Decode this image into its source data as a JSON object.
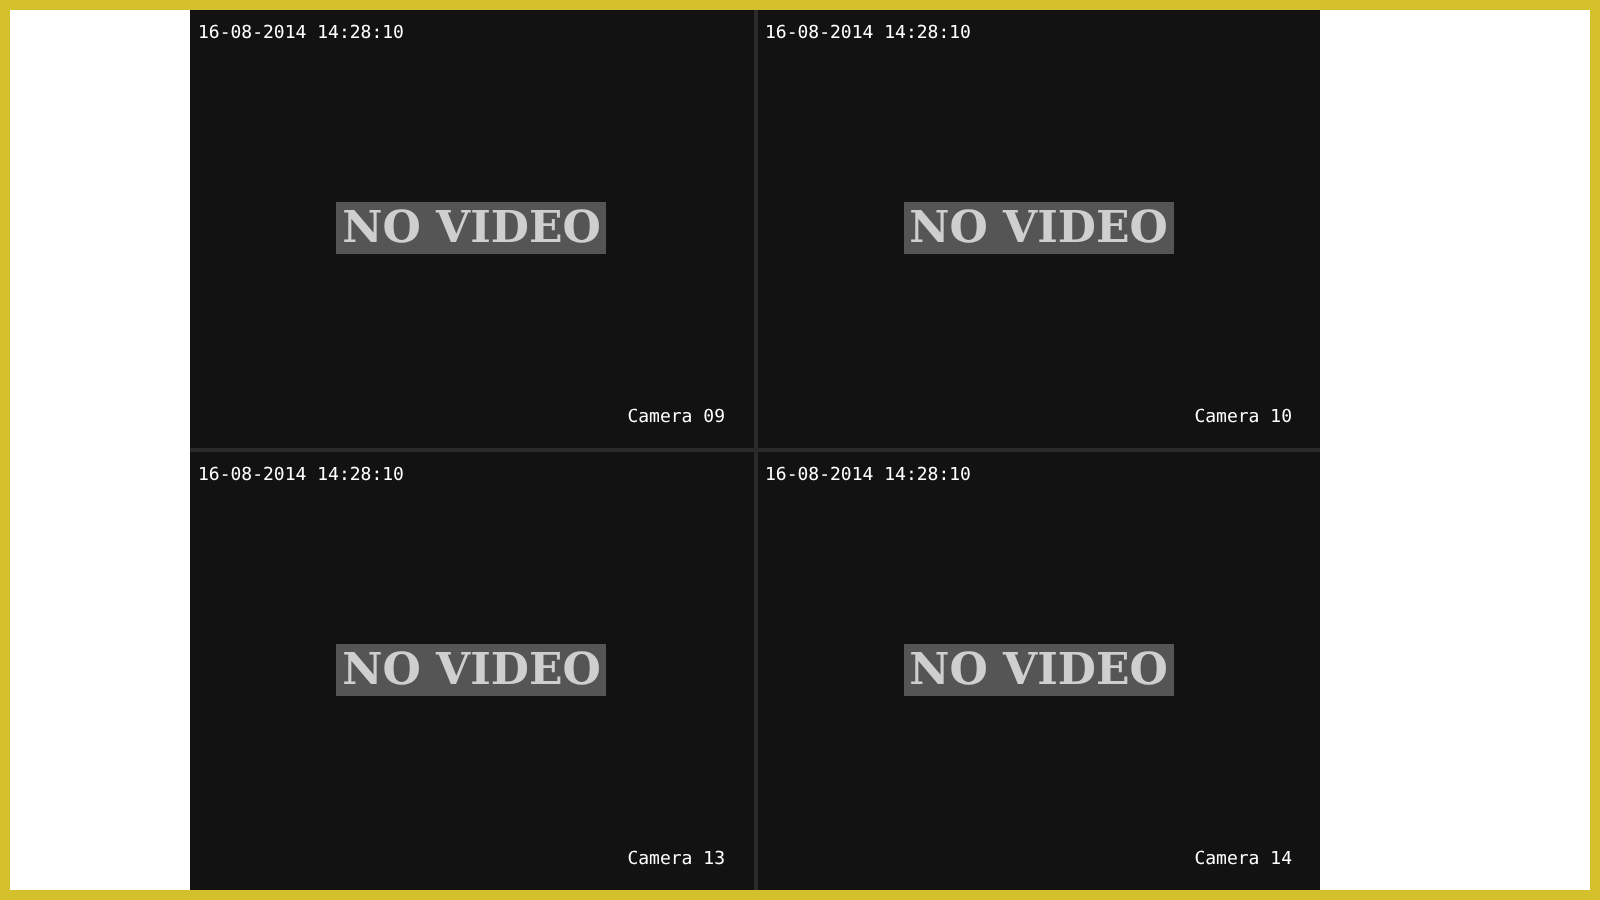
{
  "tiles": [
    {
      "timestamp": "16-08-2014 14:28:10",
      "status": "NO VIDEO",
      "camera": "Camera 09"
    },
    {
      "timestamp": "16-08-2014 14:28:10",
      "status": "NO VIDEO",
      "camera": "Camera 10"
    },
    {
      "timestamp": "16-08-2014 14:28:10",
      "status": "NO VIDEO",
      "camera": "Camera 13"
    },
    {
      "timestamp": "16-08-2014 14:28:10",
      "status": "NO VIDEO",
      "camera": "Camera 14"
    }
  ]
}
